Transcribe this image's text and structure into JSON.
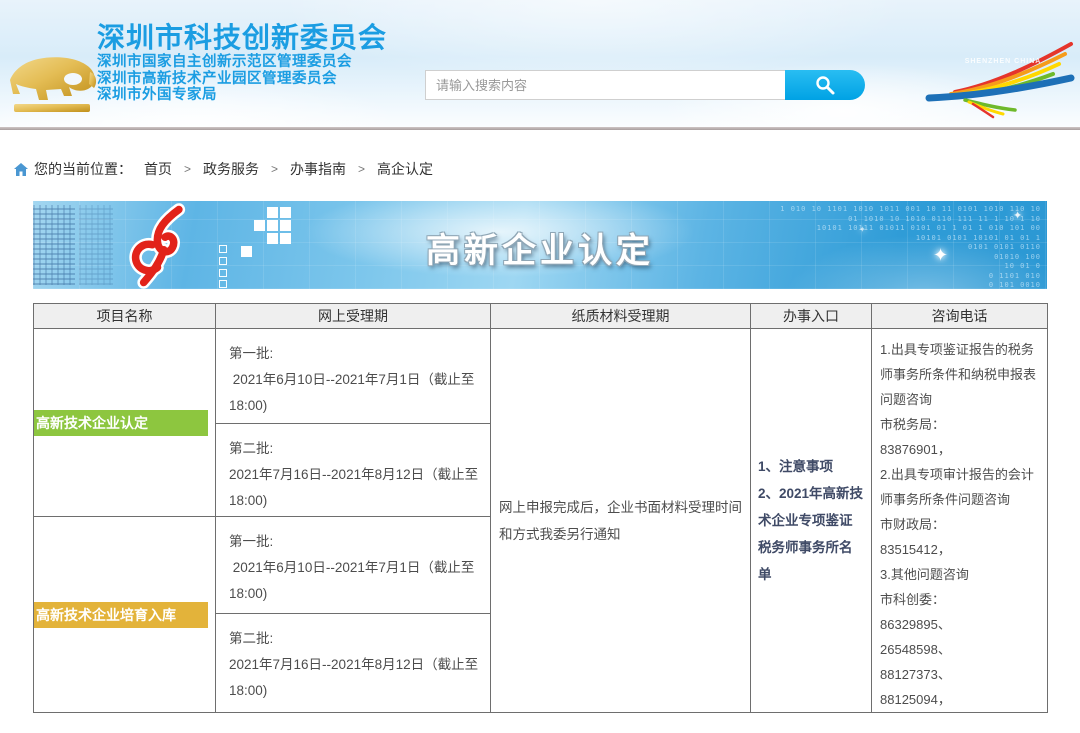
{
  "header": {
    "org_title": "深圳市科技创新委员会",
    "org_subtitles": [
      "深圳市国家自主创新示范区管理委员会",
      "深圳市高新技术产业园区管理委员会",
      "深圳市外国专家局"
    ],
    "search": {
      "placeholder": "请输入搜索内容"
    },
    "city_logo_caption": "SHENZHEN CHINA"
  },
  "breadcrumb": {
    "prefix": "您的当前位置：",
    "separator": ">",
    "items": [
      "首页",
      "政务服务",
      "办事指南",
      "高企认定"
    ]
  },
  "banner": {
    "title": "高新企业认定",
    "decor_binary": [
      "1 010 10 1101 1010 1011 001 10 11 0101 1010 110 10",
      "01 1010 10 1010 0110 111 11 1 10 1 10",
      "10101 10111 01011 0101 01 1 01 1 010 101 00",
      "10101 0101 10101 01 01 1",
      "0101 0101 0110",
      "01010 100",
      "10 01 0",
      "0 1101 010",
      "0 101 0010"
    ]
  },
  "icons": {
    "sparkle": "✦"
  },
  "table": {
    "headers": [
      "项目名称",
      "网上受理期",
      "纸质材料受理期",
      "办事入口",
      "咨询电话"
    ],
    "accent_colors": {
      "recognition_badge": "#8dc63f",
      "cultivation_badge": "#e3b33a"
    },
    "rows": [
      {
        "project": "高新技术企业认定",
        "batches": [
          {
            "label": "第一批:",
            "period": " 2021年6月10日--2021年7月1日（截止至18:00)"
          },
          {
            "label": "第二批:",
            "period": "2021年7月16日--2021年8月12日（截止至18:00)"
          }
        ]
      },
      {
        "project": "高新技术企业培育入库",
        "batches": [
          {
            "label": "第一批:",
            "period": " 2021年6月10日--2021年7月1日（截止至18:00)"
          },
          {
            "label": "第二批:",
            "period": "2021年7月16日--2021年8月12日（截止至18:00)"
          }
        ]
      }
    ],
    "paper_note": "网上申报完成后，企业书面材料受理时间和方式我委另行通知",
    "entry_links": [
      "1、注意事项",
      "2、2021年高新技术企业专项鉴证税务师事务所名单"
    ],
    "consult_lines": [
      "1.出具专项鉴证报告的税务师事务所条件和纳税申报表问题咨询",
      "市税务局：",
      "83876901，",
      "2.出具专项审计报告的会计师事务所条件问题咨询",
      "市财政局：",
      "83515412，",
      "3.其他问题咨询",
      "市科创委：",
      "86329895、",
      "26548598、",
      "88127373、",
      "88125094，"
    ]
  }
}
